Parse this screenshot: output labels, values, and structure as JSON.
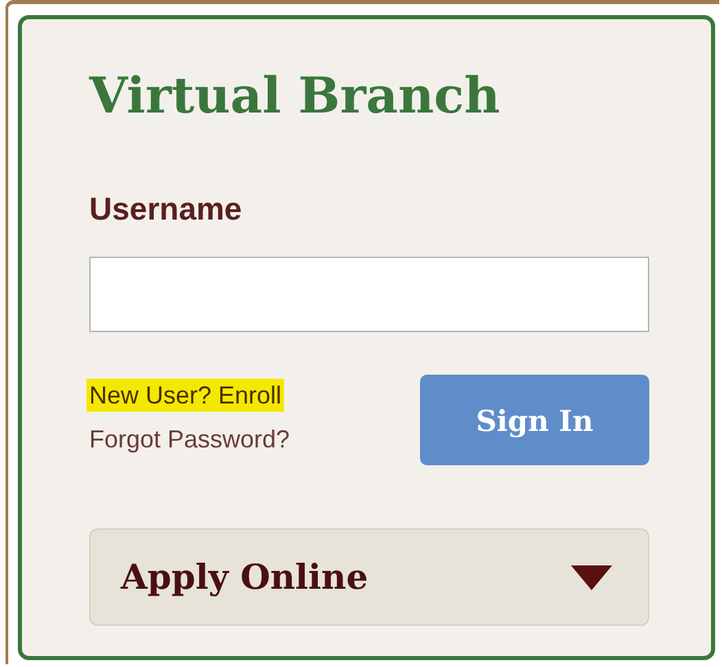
{
  "title": "Virtual Branch",
  "username": {
    "label": "Username"
  },
  "links": [
    {
      "text": "New User? Enroll",
      "highlighted": true
    },
    {
      "text": "Forgot Password?",
      "highlighted": false
    }
  ],
  "sign_in_button": "Sign In",
  "apply_dropdown": {
    "label": "Apply Online",
    "expanded": false
  }
}
